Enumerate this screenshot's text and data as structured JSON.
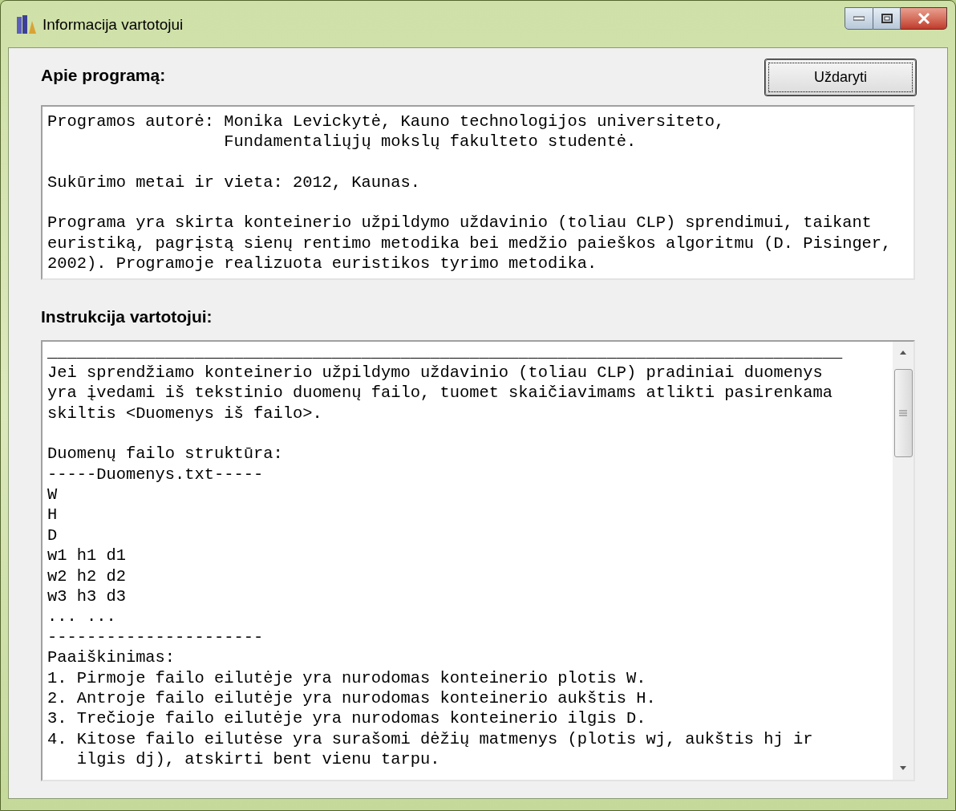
{
  "window": {
    "title": "Informacija vartotojui"
  },
  "close_button": {
    "label": "Uždaryti",
    "focused": true
  },
  "about": {
    "heading": "Apie programą:",
    "blocks": [
      {
        "lines": [
          "Programos autorė: Monika Levickytė, Kauno technologijos universiteto,",
          "                  Fundamentaliųjų mokslų fakulteto studentė."
        ]
      },
      {
        "lines": [
          "Sukūrimo metai ir vieta: 2012, Kaunas."
        ]
      },
      {
        "lines": [
          "Programa yra skirta konteinerio užpildymo uždavinio (toliau CLP) sprendimui, taikant",
          "euristiką, pagrįstą sienų rentimo metodika bei medžio paieškos algoritmu (D. Pisinger,",
          "2002). Programoje realizuota euristikos tyrimo metodika."
        ]
      }
    ]
  },
  "instructions": {
    "heading": "Instrukcija vartotojui:",
    "blocks": [
      {
        "lines": [
          "_________________________________________________________________________________",
          "Jei sprendžiamo konteinerio užpildymo uždavinio (toliau CLP) pradiniai duomenys",
          "yra įvedami iš tekstinio duomenų failo, tuomet skaičiavimams atlikti pasirenkama",
          "skiltis <Duomenys iš failo>."
        ]
      },
      {
        "lines": [
          "Duomenų failo struktūra:",
          "-----Duomenys.txt-----",
          "W",
          "H",
          "D",
          "w1 h1 d1",
          "w2 h2 d2",
          "w3 h3 d3",
          "... ...",
          "----------------------",
          "Paaiškinimas:",
          "1. Pirmoje failo eilutėje yra nurodomas konteinerio plotis W.",
          "2. Antroje failo eilutėje yra nurodomas konteinerio aukštis H.",
          "3. Trečioje failo eilutėje yra nurodomas konteinerio ilgis D.",
          "4. Kitose failo eilutėse yra surašomi dėžių matmenys (plotis wj, aukštis hj ir",
          "   ilgis dj), atskirti bent vienu tarpu."
        ]
      }
    ]
  }
}
